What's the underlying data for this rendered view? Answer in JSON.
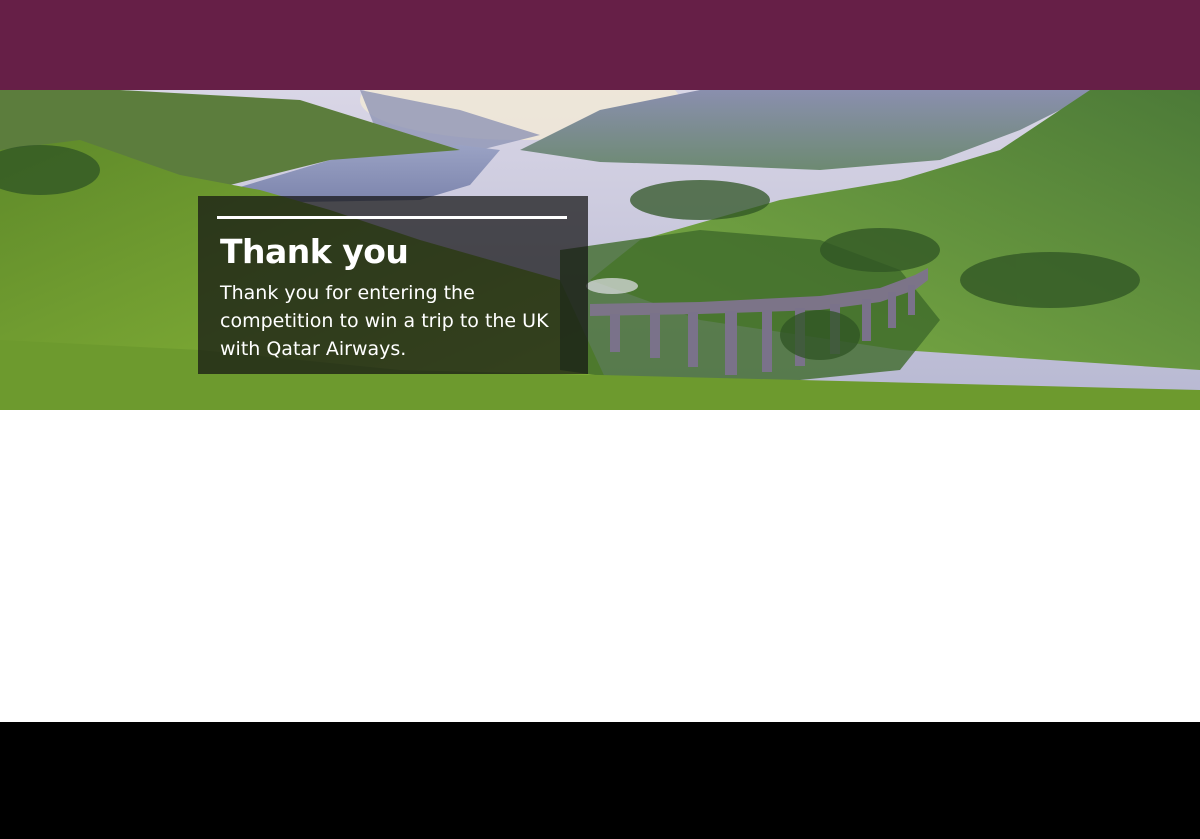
{
  "header": {
    "bar_color": "#661f47"
  },
  "hero": {
    "image_description_icon": "landscape-photo",
    "card": {
      "title": "Thank you",
      "body": "Thank you for entering the competition to win a trip to the UK with Qatar Airways."
    }
  },
  "footer": {
    "bar_color": "#000000"
  }
}
